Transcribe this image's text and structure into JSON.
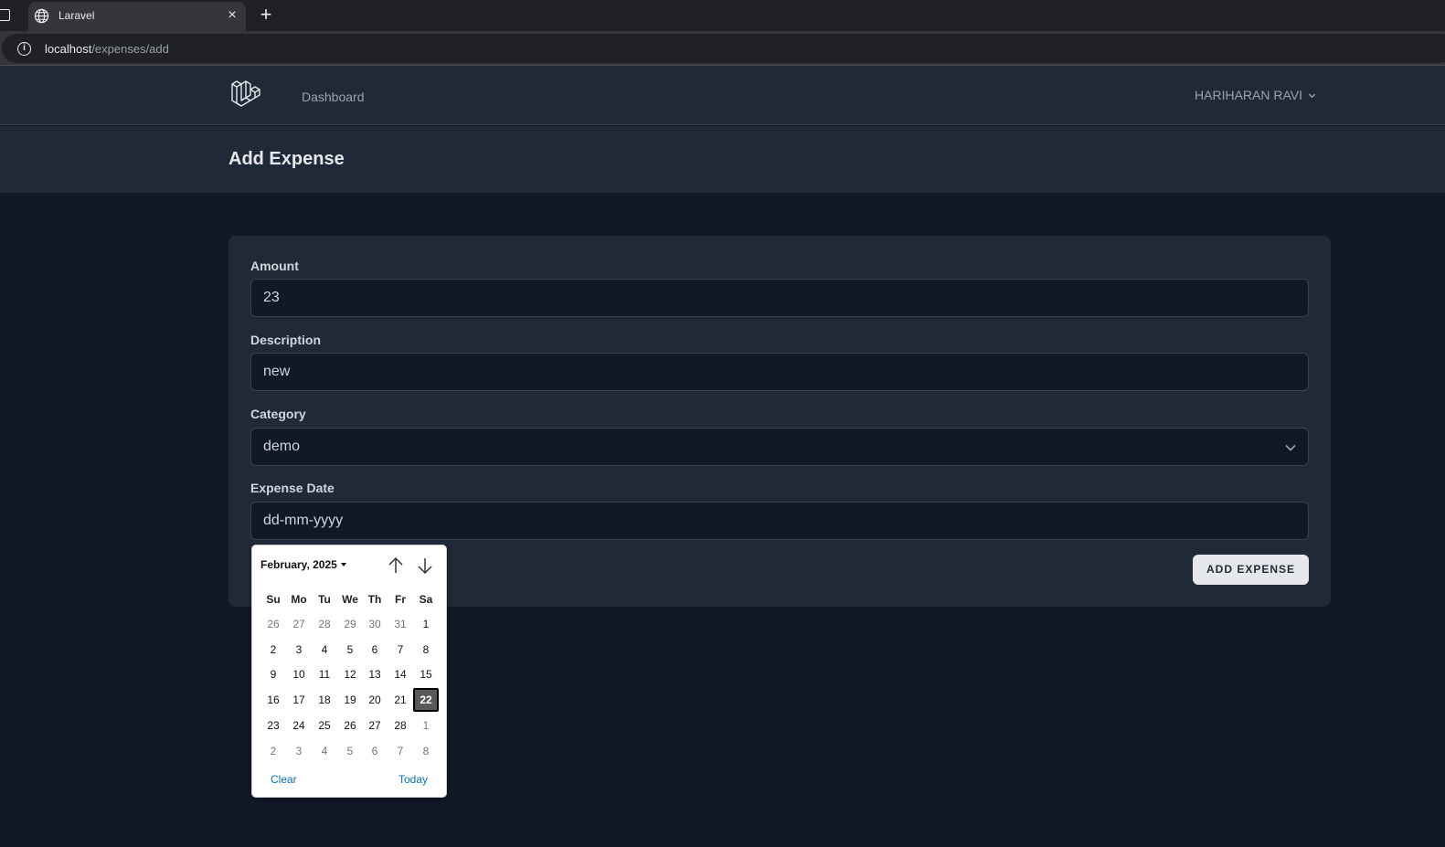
{
  "browser": {
    "tab_title": "Laravel",
    "url_host": "localhost",
    "url_path": "/expenses/add"
  },
  "nav": {
    "dashboard_label": "Dashboard",
    "user_name": "HARIHARAN RAVI"
  },
  "page": {
    "title": "Add Expense"
  },
  "form": {
    "amount_label": "Amount",
    "amount_value": "23",
    "description_label": "Description",
    "description_value": "new",
    "category_label": "Category",
    "category_value": "demo",
    "date_label": "Expense Date",
    "date_placeholder": "dd-mm-yyyy",
    "submit_label": "ADD EXPENSE"
  },
  "datepicker": {
    "month_label": "February, 2025",
    "weekdays": [
      "Su",
      "Mo",
      "Tu",
      "We",
      "Th",
      "Fr",
      "Sa"
    ],
    "weeks": [
      [
        "26",
        "27",
        "28",
        "29",
        "30",
        "31",
        "1"
      ],
      [
        "2",
        "3",
        "4",
        "5",
        "6",
        "7",
        "8"
      ],
      [
        "9",
        "10",
        "11",
        "12",
        "13",
        "14",
        "15"
      ],
      [
        "16",
        "17",
        "18",
        "19",
        "20",
        "21",
        "22"
      ],
      [
        "23",
        "24",
        "25",
        "26",
        "27",
        "28",
        "1"
      ],
      [
        "2",
        "3",
        "4",
        "5",
        "6",
        "7",
        "8"
      ]
    ],
    "selected_day": "22",
    "clear_label": "Clear",
    "today_label": "Today"
  },
  "colors": {
    "page_bg": "#111827",
    "nav_bg": "#1f2937",
    "link_blue": "#0b6fc6"
  }
}
